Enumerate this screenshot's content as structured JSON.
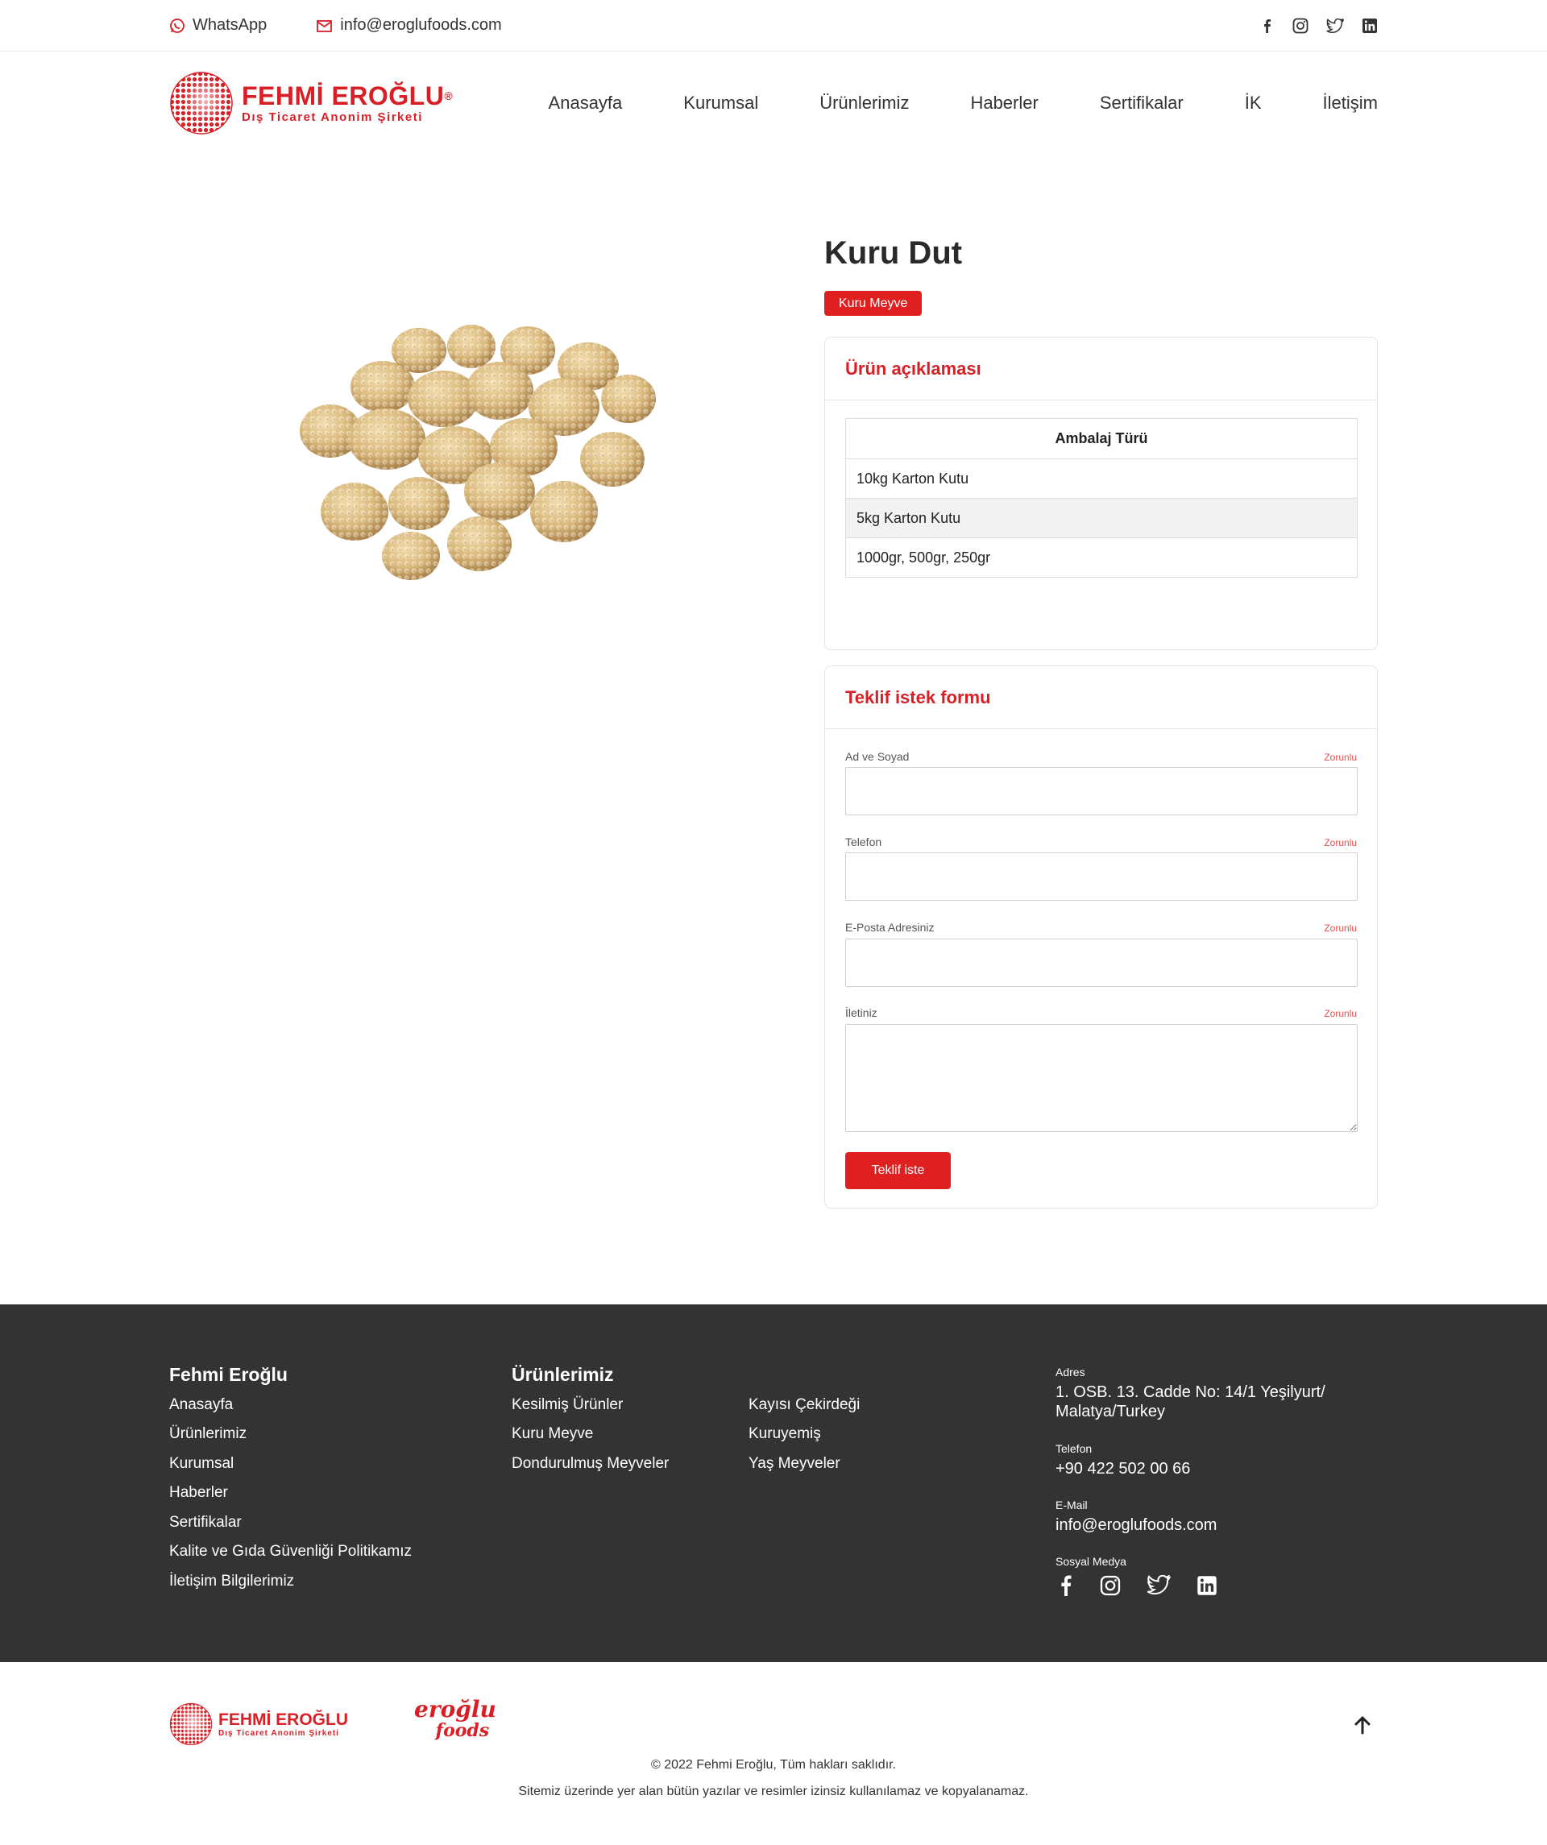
{
  "topbar": {
    "whatsapp_label": "WhatsApp",
    "email": "info@eroglufoods.com"
  },
  "header": {
    "logo_title": "FEHMİ EROĞLU",
    "logo_reg": "®",
    "logo_subtitle": "Dış Ticaret Anonim Şirketi",
    "nav": [
      "Anasayfa",
      "Kurumsal",
      "Ürünlerimiz",
      "Haberler",
      "Sertifikalar",
      "İK",
      "İletişim"
    ]
  },
  "product": {
    "title": "Kuru Dut",
    "category_badge": "Kuru Meyve",
    "description_title": "Ürün açıklaması",
    "table_header": "Ambalaj Türü",
    "table_rows": [
      "10kg Karton Kutu",
      "5kg Karton Kutu",
      "1000gr, 500gr, 250gr"
    ]
  },
  "form": {
    "title": "Teklif istek formu",
    "required_label": "Zorunlu",
    "fields": [
      "Ad ve Soyad",
      "Telefon",
      "E-Posta Adresiniz",
      "İletiniz"
    ],
    "submit_label": "Teklif iste"
  },
  "footer": {
    "col1_title": "Fehmi Eroğlu",
    "col1_links": [
      "Anasayfa",
      "Ürünlerimiz",
      "Kurumsal",
      "Haberler",
      "Sertifikalar",
      "Kalite ve Gıda Güvenliği Politikamız",
      "İletişim Bilgilerimiz"
    ],
    "col2_title": "Ürünlerimiz",
    "col2_links_a": [
      "Kesilmiş Ürünler",
      "Kuru Meyve",
      "Dondurulmuş Meyveler"
    ],
    "col2_links_b": [
      "Kayısı Çekirdeği",
      "Kuruyemiş",
      "Yaş Meyveler"
    ],
    "address_label": "Adres",
    "address_line1": "1. OSB. 13. Cadde No: 14/1 Yeşilyurt/",
    "address_line2": "Malatya/Turkey",
    "phone_label": "Telefon",
    "phone": "+90 422 502 00 66",
    "email_label": "E-Mail",
    "email": "info@eroglufoods.com",
    "social_label": "Sosyal Medya"
  },
  "bottom": {
    "logo_title": "FEHMİ EROĞLU",
    "logo_subtitle": "Dış Ticaret Anonim Şirketi",
    "foods_logo_line1": "eroğlu",
    "foods_logo_line2": "foods",
    "copyright": "© 2022 Fehmi Eroğlu, Tüm hakları saklıdır.",
    "notice": "Sitemiz üzerinde yer alan bütün yazılar ve resimler izinsiz kullanılamaz ve kopyalanamaz."
  },
  "colors": {
    "brand_red": "#d81f26",
    "footer_bg": "#333333"
  },
  "icons": [
    "whatsapp-icon",
    "mail-icon",
    "facebook-icon",
    "instagram-icon",
    "twitter-icon",
    "linkedin-icon",
    "arrow-up-icon"
  ]
}
